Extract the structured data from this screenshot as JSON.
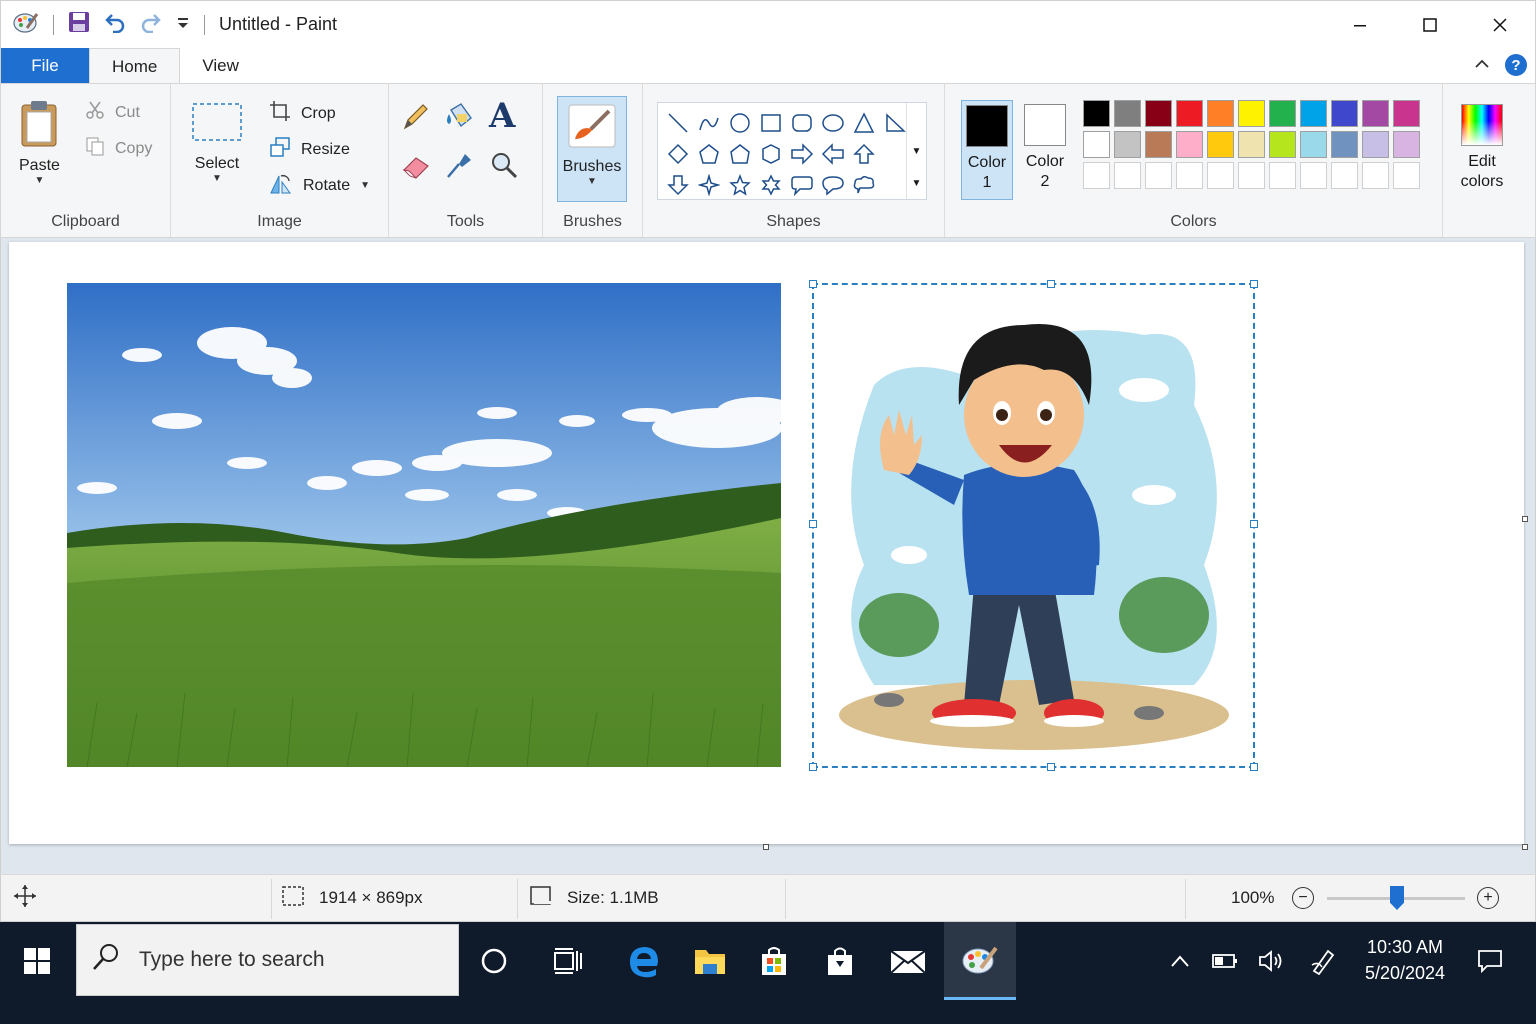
{
  "window": {
    "title": "Untitled - Paint",
    "controls": [
      "minimize",
      "maximize",
      "close"
    ]
  },
  "quick_access": {
    "icons": [
      "paint-app-icon",
      "save-icon",
      "undo-icon",
      "redo-icon",
      "customize-dropdown-icon"
    ]
  },
  "tabs": [
    {
      "label": "File"
    },
    {
      "label": "Home"
    },
    {
      "label": "View"
    }
  ],
  "clipboard": {
    "paste": "Paste",
    "cut": "Cut",
    "copy": "Copy",
    "group": "Clipboard"
  },
  "image": {
    "select": "Select",
    "crop": "Crop",
    "resize": "Resize",
    "rotate": "Rotate",
    "group": "Image"
  },
  "tools": {
    "group": "Tools",
    "items": [
      "pencil-icon",
      "fill-icon",
      "text-icon",
      "eraser-icon",
      "color-picker-icon",
      "magnifier-icon"
    ]
  },
  "brushes": {
    "label": "Brushes",
    "group": "Brushes"
  },
  "shapes": {
    "group": "Shapes",
    "items": [
      "line",
      "curve",
      "oval",
      "rectangle",
      "rounded-rectangle",
      "ellipse",
      "triangle",
      "right-triangle",
      "diamond",
      "pentagon",
      "hexagon-up",
      "hexagon",
      "right-arrow",
      "left-arrow",
      "up-arrow",
      "down-arrow",
      "four-point-star",
      "five-point-star",
      "six-point-star",
      "rounded-callout",
      "oval-callout",
      "cloud-callout"
    ]
  },
  "colors": {
    "group": "Colors",
    "color1": {
      "line1": "Color",
      "line2": "1",
      "value": "#000000"
    },
    "color2": {
      "line1": "Color",
      "line2": "2",
      "value": "#ffffff"
    },
    "edit": {
      "line1": "Edit",
      "line2": "colors"
    },
    "palette_row1": [
      "#000000",
      "#7f7f7f",
      "#880015",
      "#ed1c24",
      "#ff7f27",
      "#fff200",
      "#22b14c",
      "#00a2e8",
      "#3f48cc",
      "#a349a4",
      "#c9358e"
    ],
    "palette_row2": [
      "#ffffff",
      "#c3c3c3",
      "#b97a57",
      "#ffaec9",
      "#ffc90e",
      "#efe4b0",
      "#b5e61d",
      "#99d9ea",
      "#7092be",
      "#c8bfe7",
      "#d8b4e2"
    ],
    "palette_row3": [
      "#ffffff",
      "#ffffff",
      "#ffffff",
      "#ffffff",
      "#ffffff",
      "#ffffff",
      "#ffffff",
      "#ffffff",
      "#ffffff",
      "#ffffff",
      "#ffffff"
    ]
  },
  "status": {
    "selection_size": "1914 × 869px",
    "file_size": "Size: 1.1MB",
    "zoom": "100%",
    "zoom_level": 0.5
  },
  "taskbar": {
    "search_placeholder": "Type here to search",
    "time": "10:30 AM",
    "date": "5/20/2024",
    "icons": [
      "windows-start-icon",
      "cortana-icon",
      "task-view-icon",
      "edge-icon",
      "file-explorer-icon",
      "store-icon",
      "shopping-bag-icon",
      "mail-icon",
      "paint-taskbar-icon"
    ],
    "tray": [
      "chevron-up-icon",
      "battery-icon",
      "volume-icon",
      "pen-icon",
      "notification-icon"
    ]
  }
}
